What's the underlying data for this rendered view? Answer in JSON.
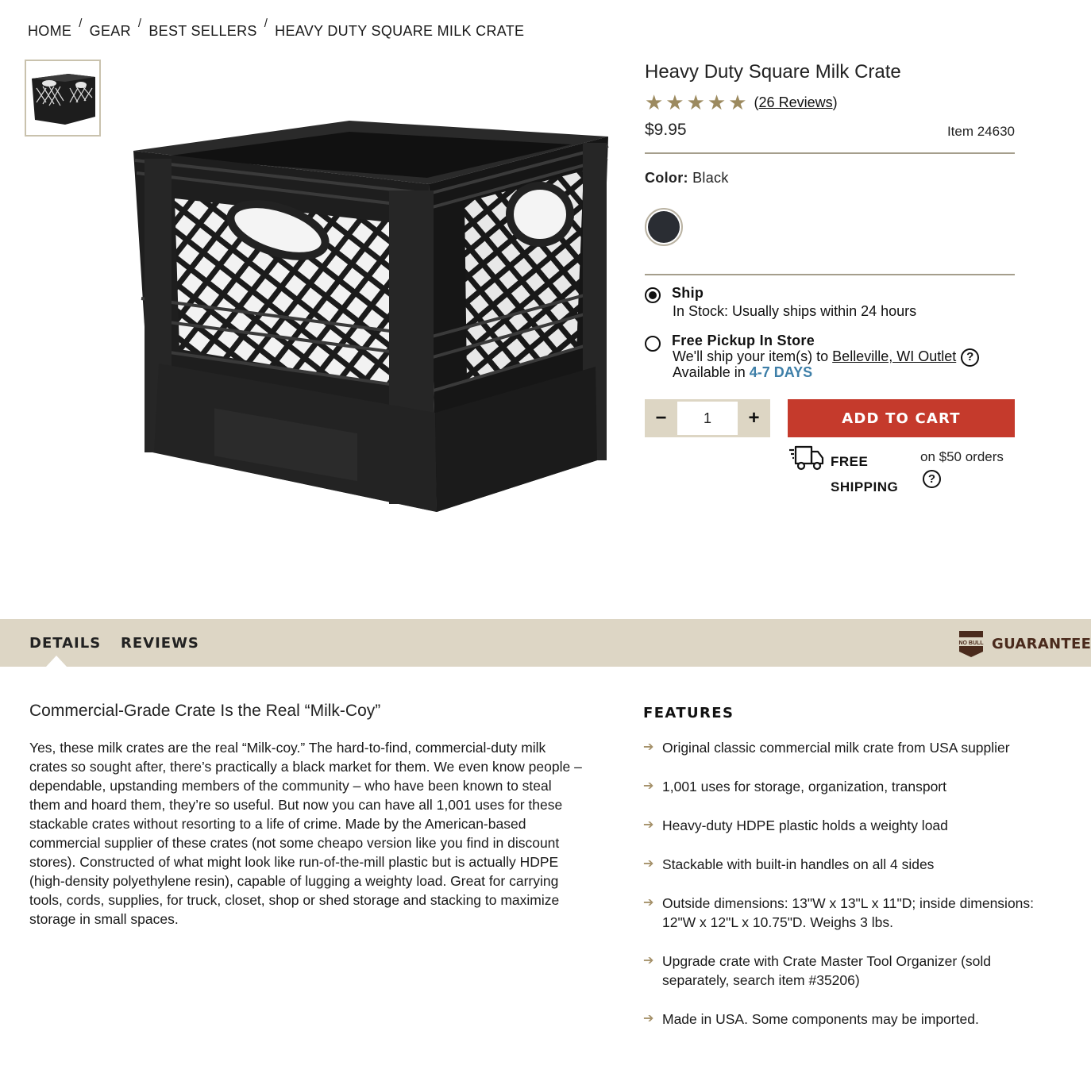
{
  "breadcrumb": [
    {
      "label": "HOME"
    },
    {
      "label": "GEAR"
    },
    {
      "label": "BEST SELLERS"
    },
    {
      "label": "HEAVY DUTY SQUARE MILK CRATE"
    }
  ],
  "product": {
    "title": "Heavy Duty Square Milk Crate",
    "rating": 5,
    "rating_stars": "★★★★★",
    "reviews_link": "26 Reviews",
    "price": "$9.95",
    "item_number": "Item 24630",
    "color_label": "Color:",
    "color_value": "Black",
    "swatch_color": "#2a2d33"
  },
  "fulfillment": {
    "ship_title": "Ship",
    "ship_text": "In Stock: Usually ships within 24 hours",
    "pickup_title": "Free Pickup In Store",
    "pickup_text_prefix": "We'll ship your item(s) to",
    "pickup_store": "Belleville, WI Outlet",
    "pickup_available_prefix": "Available in",
    "pickup_days": "4-7 DAYS",
    "help_glyph": "?"
  },
  "cart": {
    "minus": "−",
    "quantity": "1",
    "plus": "+",
    "add_to_cart": "ADD TO CART",
    "free_shipping_line1": "FREE",
    "free_shipping_line2": "SHIPPING",
    "free_shipping_threshold": "on $50 orders"
  },
  "tabs": {
    "details": "DETAILS",
    "reviews": "REVIEWS",
    "guarantee": "GUARANTEE",
    "guarantee_badge": "NO BULL"
  },
  "details": {
    "heading": "Commercial-Grade Crate Is the Real “Milk-Coy”",
    "body": "Yes, these milk crates are the real “Milk-coy.” The hard-to-find, commercial-duty milk crates so sought after, there’s practically a black market for them. We even know people – dependable, upstanding members of the community – who have been known to steal them and hoard them, they’re so useful. But now you can have all 1,001 uses for these stackable crates without resorting to a life of crime. Made by the American-based commercial supplier of these crates (not some cheapo version like you find in discount stores). Constructed of what might look like run-of-the-mill plastic but is actually HDPE (high-density polyethylene resin), capable of lugging a weighty load. Great for carrying tools, cords, supplies, for truck, closet, shop or shed storage and stacking to maximize storage in small spaces."
  },
  "features": {
    "heading": "FEATURES",
    "items": [
      "Original classic commercial milk crate from USA supplier",
      "1,001 uses for storage, organization, transport",
      "Heavy-duty HDPE plastic holds a weighty load",
      "Stackable with built-in handles on all 4 sides",
      "Outside dimensions: 13\"W x 13\"L x 11\"D; inside dimensions: 12\"W x 12\"L x 10.75\"D. Weighs 3 lbs.",
      "Upgrade crate with Crate Master Tool Organizer (sold separately, search item #35206)",
      "Made in USA. Some components may be imported."
    ]
  },
  "colors": {
    "accent_red": "#c53a2c",
    "tan_band": "#ddd6c5",
    "star_gold": "#9c8a5f",
    "link_blue": "#3e7fa8",
    "guarantee_brown": "#4a2a1c"
  }
}
